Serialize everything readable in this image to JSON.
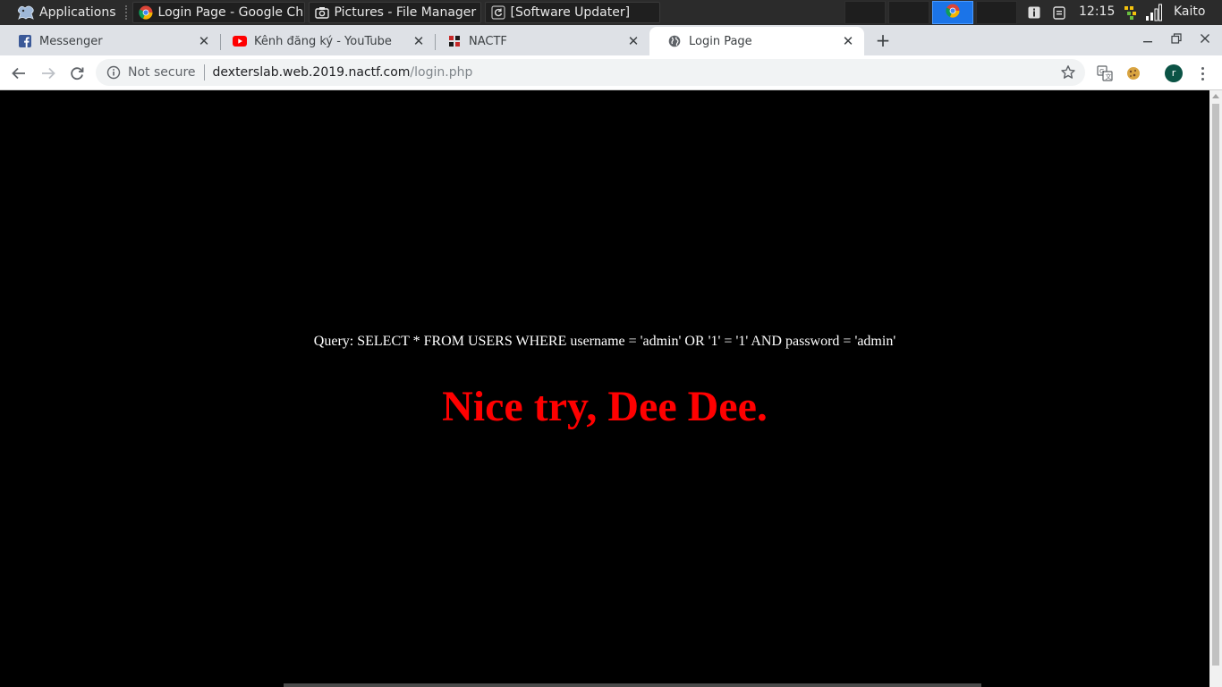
{
  "panel": {
    "apps_label": "Applications",
    "tasks": [
      {
        "label": "Login Page - Google Ch...",
        "icon": "chrome-icon"
      },
      {
        "label": "Pictures - File Manager",
        "icon": "camera-icon"
      },
      {
        "label": "[Software Updater]",
        "icon": "updater-icon"
      }
    ],
    "clock": "12:15",
    "user": "Kaito"
  },
  "tabs": [
    {
      "title": "Messenger",
      "icon": "facebook-icon",
      "color": "#3b5998",
      "active": false
    },
    {
      "title": "Kênh đăng ký - YouTube",
      "icon": "youtube-icon",
      "color": "#ff0000",
      "active": false
    },
    {
      "title": "NACTF",
      "icon": "nactf-icon",
      "color": "#c62828",
      "active": false
    },
    {
      "title": "Login Page",
      "icon": "globe-icon",
      "color": "#5f6368",
      "active": true
    }
  ],
  "omnibox": {
    "security": "Not secure",
    "host": "dexterslab.web.2019.nactf.com",
    "path": "/login.php"
  },
  "profile_initial": "r",
  "page": {
    "query": "Query: SELECT * FROM USERS WHERE username = 'admin' OR '1' = '1' AND password = 'admin'",
    "headline": "Nice try, Dee Dee.",
    "headline_color": "#ff0000",
    "background": "#000000"
  }
}
